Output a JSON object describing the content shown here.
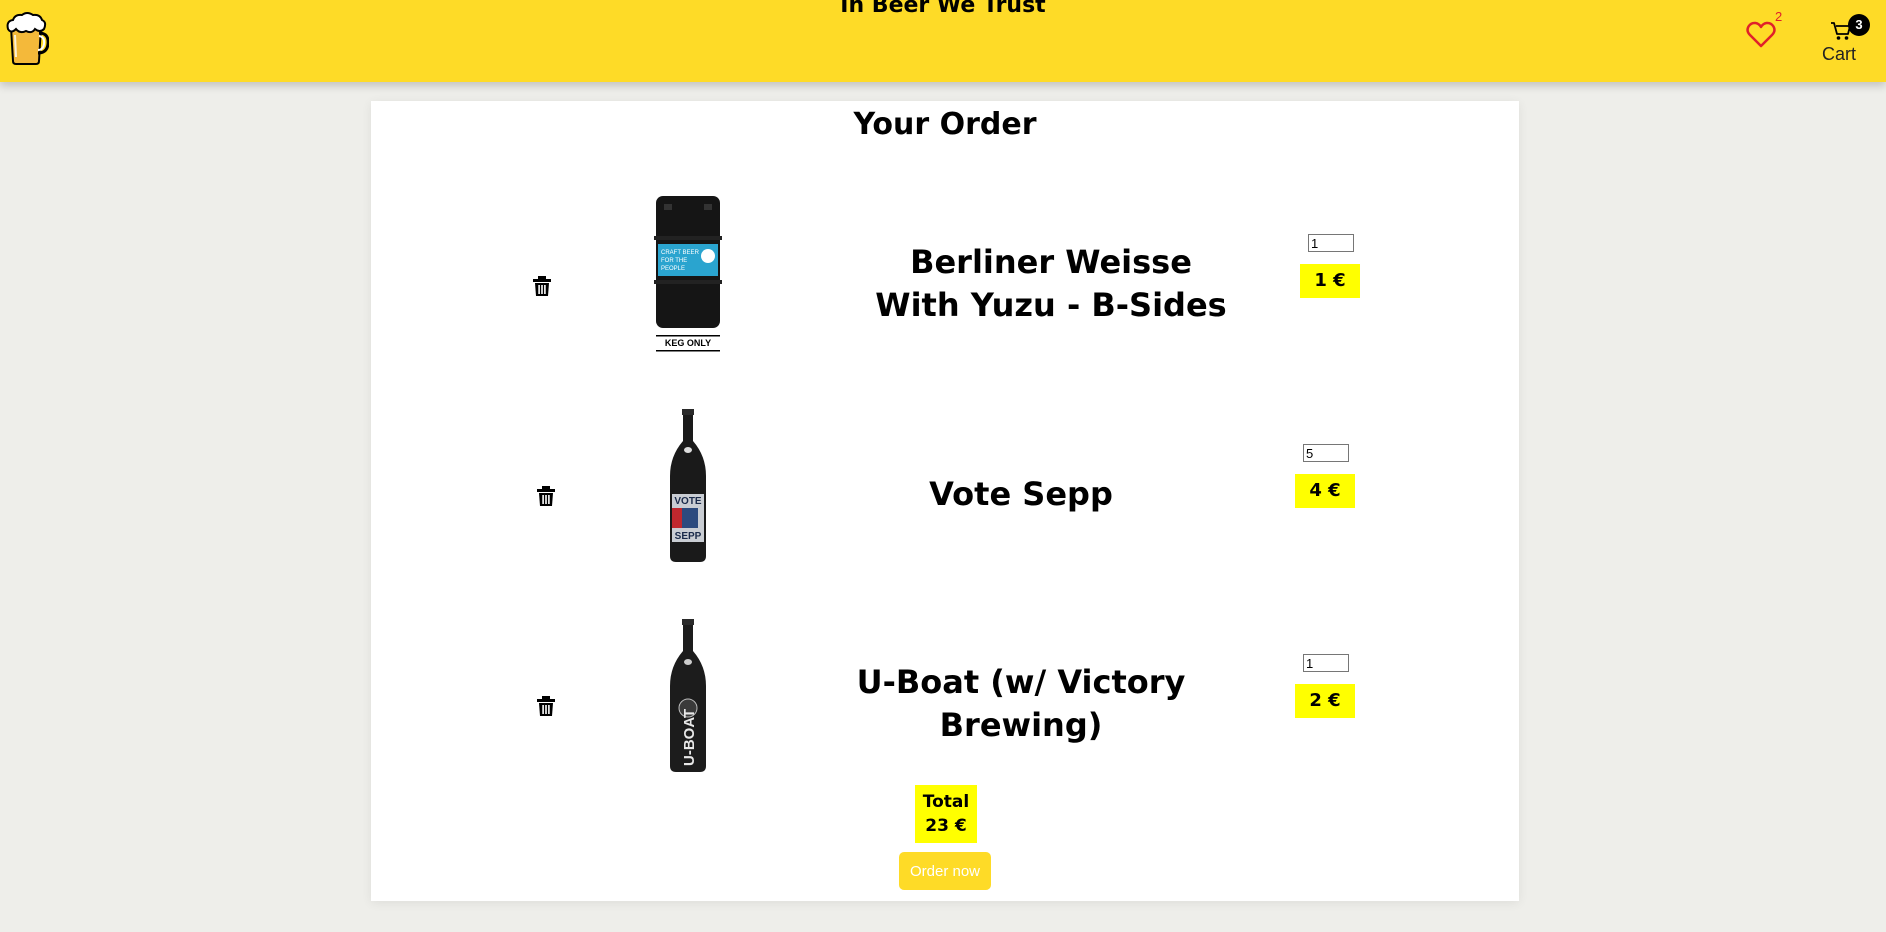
{
  "header": {
    "title": "In Beer We Trust",
    "favorites_count": "2",
    "cart_count": "3",
    "cart_label": "Cart"
  },
  "order": {
    "title": "Your Order",
    "items": [
      {
        "name": "Berliner Weisse With Yuzu - B-Sides",
        "quantity": "1",
        "price": "1 €",
        "image": "keg",
        "keg_badge": "CRAFT BEER FOR THE PEOPLE",
        "keg_label": "KEG ONLY"
      },
      {
        "name": "Vote Sepp",
        "quantity": "5",
        "price": "4 €",
        "image": "bottle",
        "bottle_label_top": "VOTE",
        "bottle_label_bottom": "SEPP"
      },
      {
        "name": "U-Boat (w/ Victory Brewing)",
        "quantity": "1",
        "price": "2 €",
        "image": "bottle",
        "bottle_label_top": "U-BOAT"
      }
    ],
    "total_label": "Total",
    "total_value": "23 €",
    "order_button": "Order now"
  },
  "colors": {
    "header_bg": "#fedb27",
    "price_bg": "#ffff00",
    "page_bg": "#eeeeea",
    "favorite_heart": "#e0202a"
  },
  "icons": [
    "beer-mug-logo-icon",
    "heart-icon",
    "cart-icon",
    "trash-icon"
  ]
}
